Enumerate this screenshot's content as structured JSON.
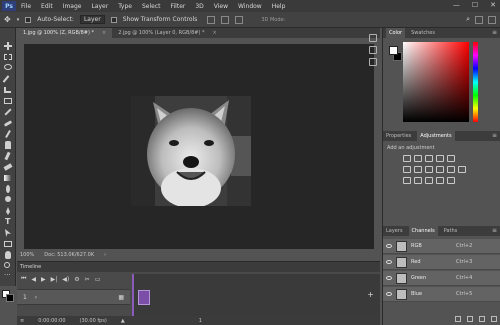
{
  "app": {
    "logo": "Ps"
  },
  "menubar": {
    "items": [
      "File",
      "Edit",
      "Image",
      "Layer",
      "Type",
      "Select",
      "Filter",
      "3D",
      "View",
      "Window",
      "Help"
    ],
    "window_controls": [
      "—",
      "☐",
      "✕"
    ]
  },
  "options": {
    "auto_select_label": "Auto-Select:",
    "auto_select_value": "Layer",
    "transform_label": "Show Transform Controls",
    "mode_3d_label": "3D Mode:"
  },
  "tabs": [
    {
      "label": "1.jpg @ 100% (Z, RGB/8#) *",
      "close": "×"
    },
    {
      "label": "2.jpg @ 100% (Layer 0, RGB/8#) *",
      "close": "×"
    }
  ],
  "status": {
    "zoom": "100%",
    "doc": "Doc: 513.0K/627.0K"
  },
  "timeline": {
    "title": "Timeline",
    "track_number": "1",
    "track_label": "Layer 0",
    "timecode": "0:00:00:00",
    "fps": "(30.00 fps)",
    "frame_number": "1"
  },
  "panels": {
    "color_tabs": [
      "Color",
      "Swatches"
    ],
    "adj_tabs": [
      "Properties",
      "Adjustments"
    ],
    "adj_title": "Add an adjustment",
    "channel_tabs": [
      "Layers",
      "Channels",
      "Paths"
    ],
    "channels": [
      {
        "name": "RGB",
        "shortcut": "Ctrl+2"
      },
      {
        "name": "Red",
        "shortcut": "Ctrl+3"
      },
      {
        "name": "Green",
        "shortcut": "Ctrl+4"
      },
      {
        "name": "Blue",
        "shortcut": "Ctrl+5"
      }
    ]
  }
}
